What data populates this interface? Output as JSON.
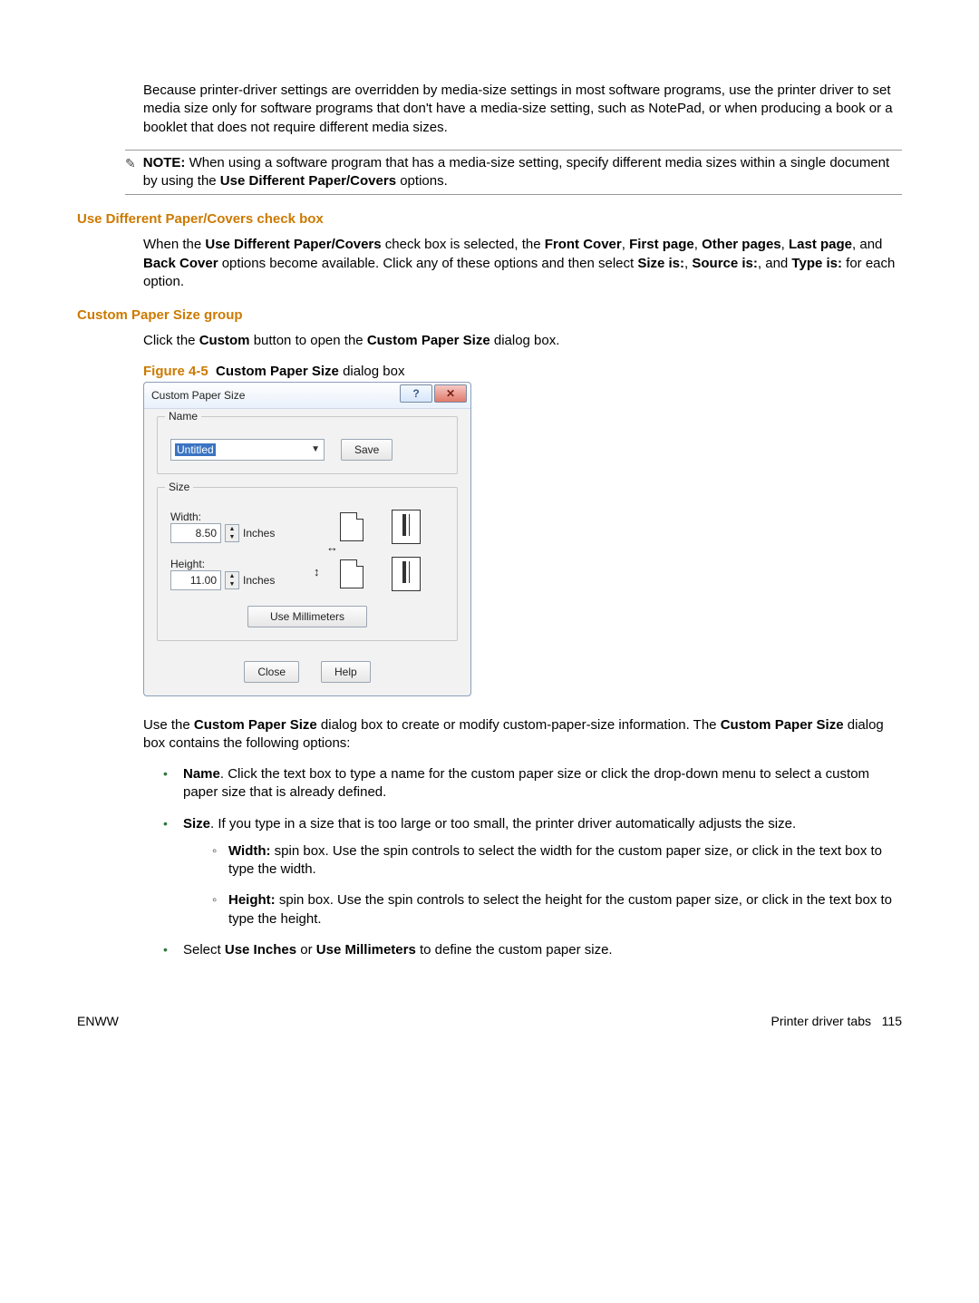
{
  "intro_para": {
    "text": "Because printer-driver settings are overridden by media-size settings in most software programs, use the printer driver to set media size only for software programs that don't have a media-size setting, such as NotePad, or when producing a book or a booklet that does not require different media sizes."
  },
  "note": {
    "label": "NOTE:",
    "text_a": "When using a software program that has a media-size setting, specify different media sizes within a single document by using the ",
    "bold_a": "Use Different Paper/Covers",
    "text_b": " options."
  },
  "heading_checkbox": "Use Different Paper/Covers check box",
  "checkbox_para": {
    "a": "When the ",
    "b": "Use Different Paper/Covers",
    "c": " check box is selected, the ",
    "d": "Front Cover",
    "e": ", ",
    "f": "First page",
    "g": ", ",
    "h": "Other pages",
    "i": ", ",
    "j": "Last page",
    "k": ", and ",
    "l": "Back Cover",
    "m": " options become available. Click any of these options and then select ",
    "n": "Size is:",
    "o": ", ",
    "p": "Source is:",
    "q": ", and ",
    "r": "Type is:",
    "s": " for each option."
  },
  "heading_custom": "Custom Paper Size group",
  "custom_para": {
    "a": "Click the ",
    "b": "Custom",
    "c": " button to open the ",
    "d": "Custom Paper Size",
    "e": " dialog box."
  },
  "figure": {
    "label": "Figure 4-5",
    "title": "Custom Paper Size",
    "suffix": " dialog box"
  },
  "dialog": {
    "title": "Custom Paper Size",
    "name_legend": "Name",
    "name_value": "Untitled",
    "save": "Save",
    "size_legend": "Size",
    "width_label": "Width:",
    "width_value": "8.50",
    "height_label": "Height:",
    "height_value": "11.00",
    "unit": "Inches",
    "millimeters_btn": "Use Millimeters",
    "close": "Close",
    "help": "Help"
  },
  "after_fig": {
    "a": "Use the ",
    "b": "Custom Paper Size",
    "c": " dialog box to create or modify custom-paper-size information. The ",
    "d": "Custom Paper Size",
    "e": " dialog box contains the following options:"
  },
  "bullets": {
    "name": {
      "b": "Name",
      "t": ". Click the text box to type a name for the custom paper size or click the drop-down menu to select a custom paper size that is already defined."
    },
    "size": {
      "b": "Size",
      "t": ". If you type in a size that is too large or too small, the printer driver automatically adjusts the size."
    },
    "width": {
      "b": "Width:",
      "t": " spin box. Use the spin controls to select the width for the custom paper size, or click in the text box to type the width."
    },
    "height": {
      "b": "Height:",
      "t": " spin box. Use the spin controls to select the height for the custom paper size, or click in the text box to type the height."
    },
    "units": {
      "a": "Select ",
      "b": "Use Inches",
      "c": " or ",
      "d": "Use Millimeters",
      "e": " to define the custom paper size."
    }
  },
  "footer": {
    "left": "ENWW",
    "right_label": "Printer driver tabs",
    "page": "115"
  }
}
